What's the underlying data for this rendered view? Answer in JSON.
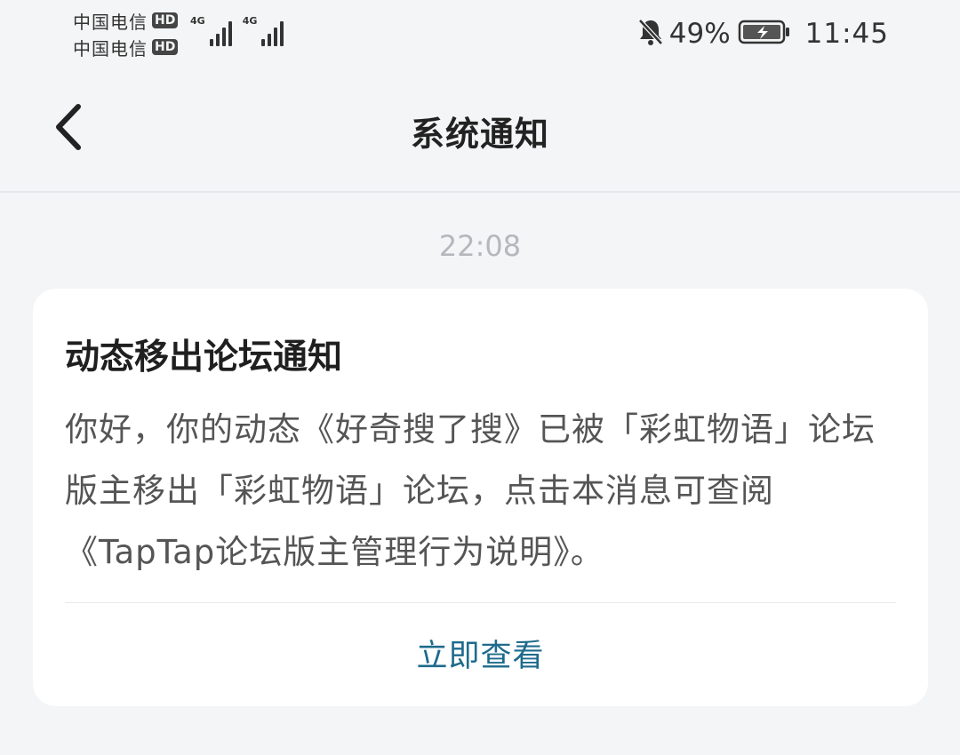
{
  "status_bar": {
    "carriers": [
      {
        "name": "中国电信",
        "badge": "HD",
        "network": "4G"
      },
      {
        "name": "中国电信",
        "badge": "HD",
        "network": "4G"
      }
    ],
    "battery_percent": "49%",
    "time": "11:45",
    "icons": [
      "signal-icon",
      "mute-bell-icon",
      "battery-charging-icon"
    ]
  },
  "header": {
    "title": "系统通知",
    "back_icon": "chevron-left-icon"
  },
  "message": {
    "timestamp": "22:08",
    "card": {
      "title": "动态移出论坛通知",
      "body": "你好，你的动态《好奇搜了搜》已被「彩虹物语」论坛版主移出「彩虹物语」论坛，点击本消息可查阅《TapTap论坛版主管理行为说明》。",
      "action_label": "立即查看"
    }
  },
  "colors": {
    "background": "#f4f5f6",
    "card": "#ffffff",
    "action_link": "#1e6b8c",
    "timestamp": "#b4b8bd"
  }
}
